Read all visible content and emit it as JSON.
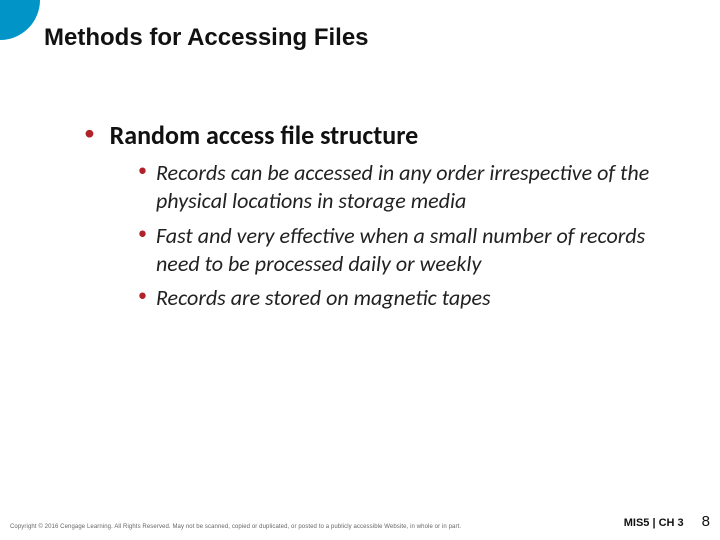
{
  "header": {
    "title": "Methods for Accessing Files"
  },
  "content": {
    "bullet1": {
      "label": "Random access file structure"
    },
    "sub": [
      {
        "text": "Records can be accessed in any order irrespective of the physical locations in storage media"
      },
      {
        "text": "Fast and very effective when a small number of records need to be processed daily or weekly"
      },
      {
        "text": "Records are stored on magnetic tapes"
      }
    ]
  },
  "footer": {
    "copyright": "Copyright © 2016 Cengage Learning. All Rights Reserved. May not be scanned, copied or duplicated, or posted to a publicly accessible Website, in whole or in part.",
    "chapter": "MIS5 | CH 3",
    "page": "8"
  }
}
